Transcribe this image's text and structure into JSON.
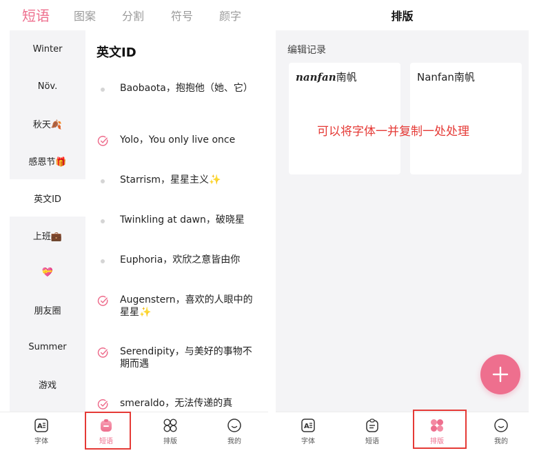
{
  "left": {
    "top_tabs": [
      "短语",
      "图案",
      "分割",
      "符号",
      "颜字"
    ],
    "sidebar": [
      "Winter",
      "Növ.",
      "秋天🍂",
      "感恩节🎁",
      "英文ID",
      "上班💼",
      "💝",
      "朋友圈",
      "Summer",
      "游戏"
    ],
    "content_title": "英文ID",
    "phrases": [
      "Baobaota，抱抱他（她、它）",
      "Yolo，You only live once",
      "Starrism，星星主义✨",
      "Twinkling at dawn，破晓星",
      "Euphoria，欢欣之意皆由你",
      "Augenstern，喜欢的人眼中的星星✨",
      "Serendipity，与美好的事物不期而遇",
      "smeraldo，无法传递的真"
    ],
    "tabbar": [
      "字体",
      "短语",
      "排版",
      "我的"
    ]
  },
  "right": {
    "header": "排版",
    "section_label": "编辑记录",
    "card1_italic": "nanfan",
    "card1_tail": "南帆",
    "card2": "Nanfan南帆",
    "overlay": "可以将字体一并复制一处处理",
    "tabbar": [
      "字体",
      "短语",
      "排版",
      "我的"
    ]
  },
  "colors": {
    "accent": "#ee6f8e",
    "annotation": "#e53935"
  },
  "icons": [
    "font-icon",
    "phrase-bag-icon",
    "layout-grid-icon",
    "profile-smile-icon",
    "plus-icon",
    "check-circle-icon"
  ]
}
